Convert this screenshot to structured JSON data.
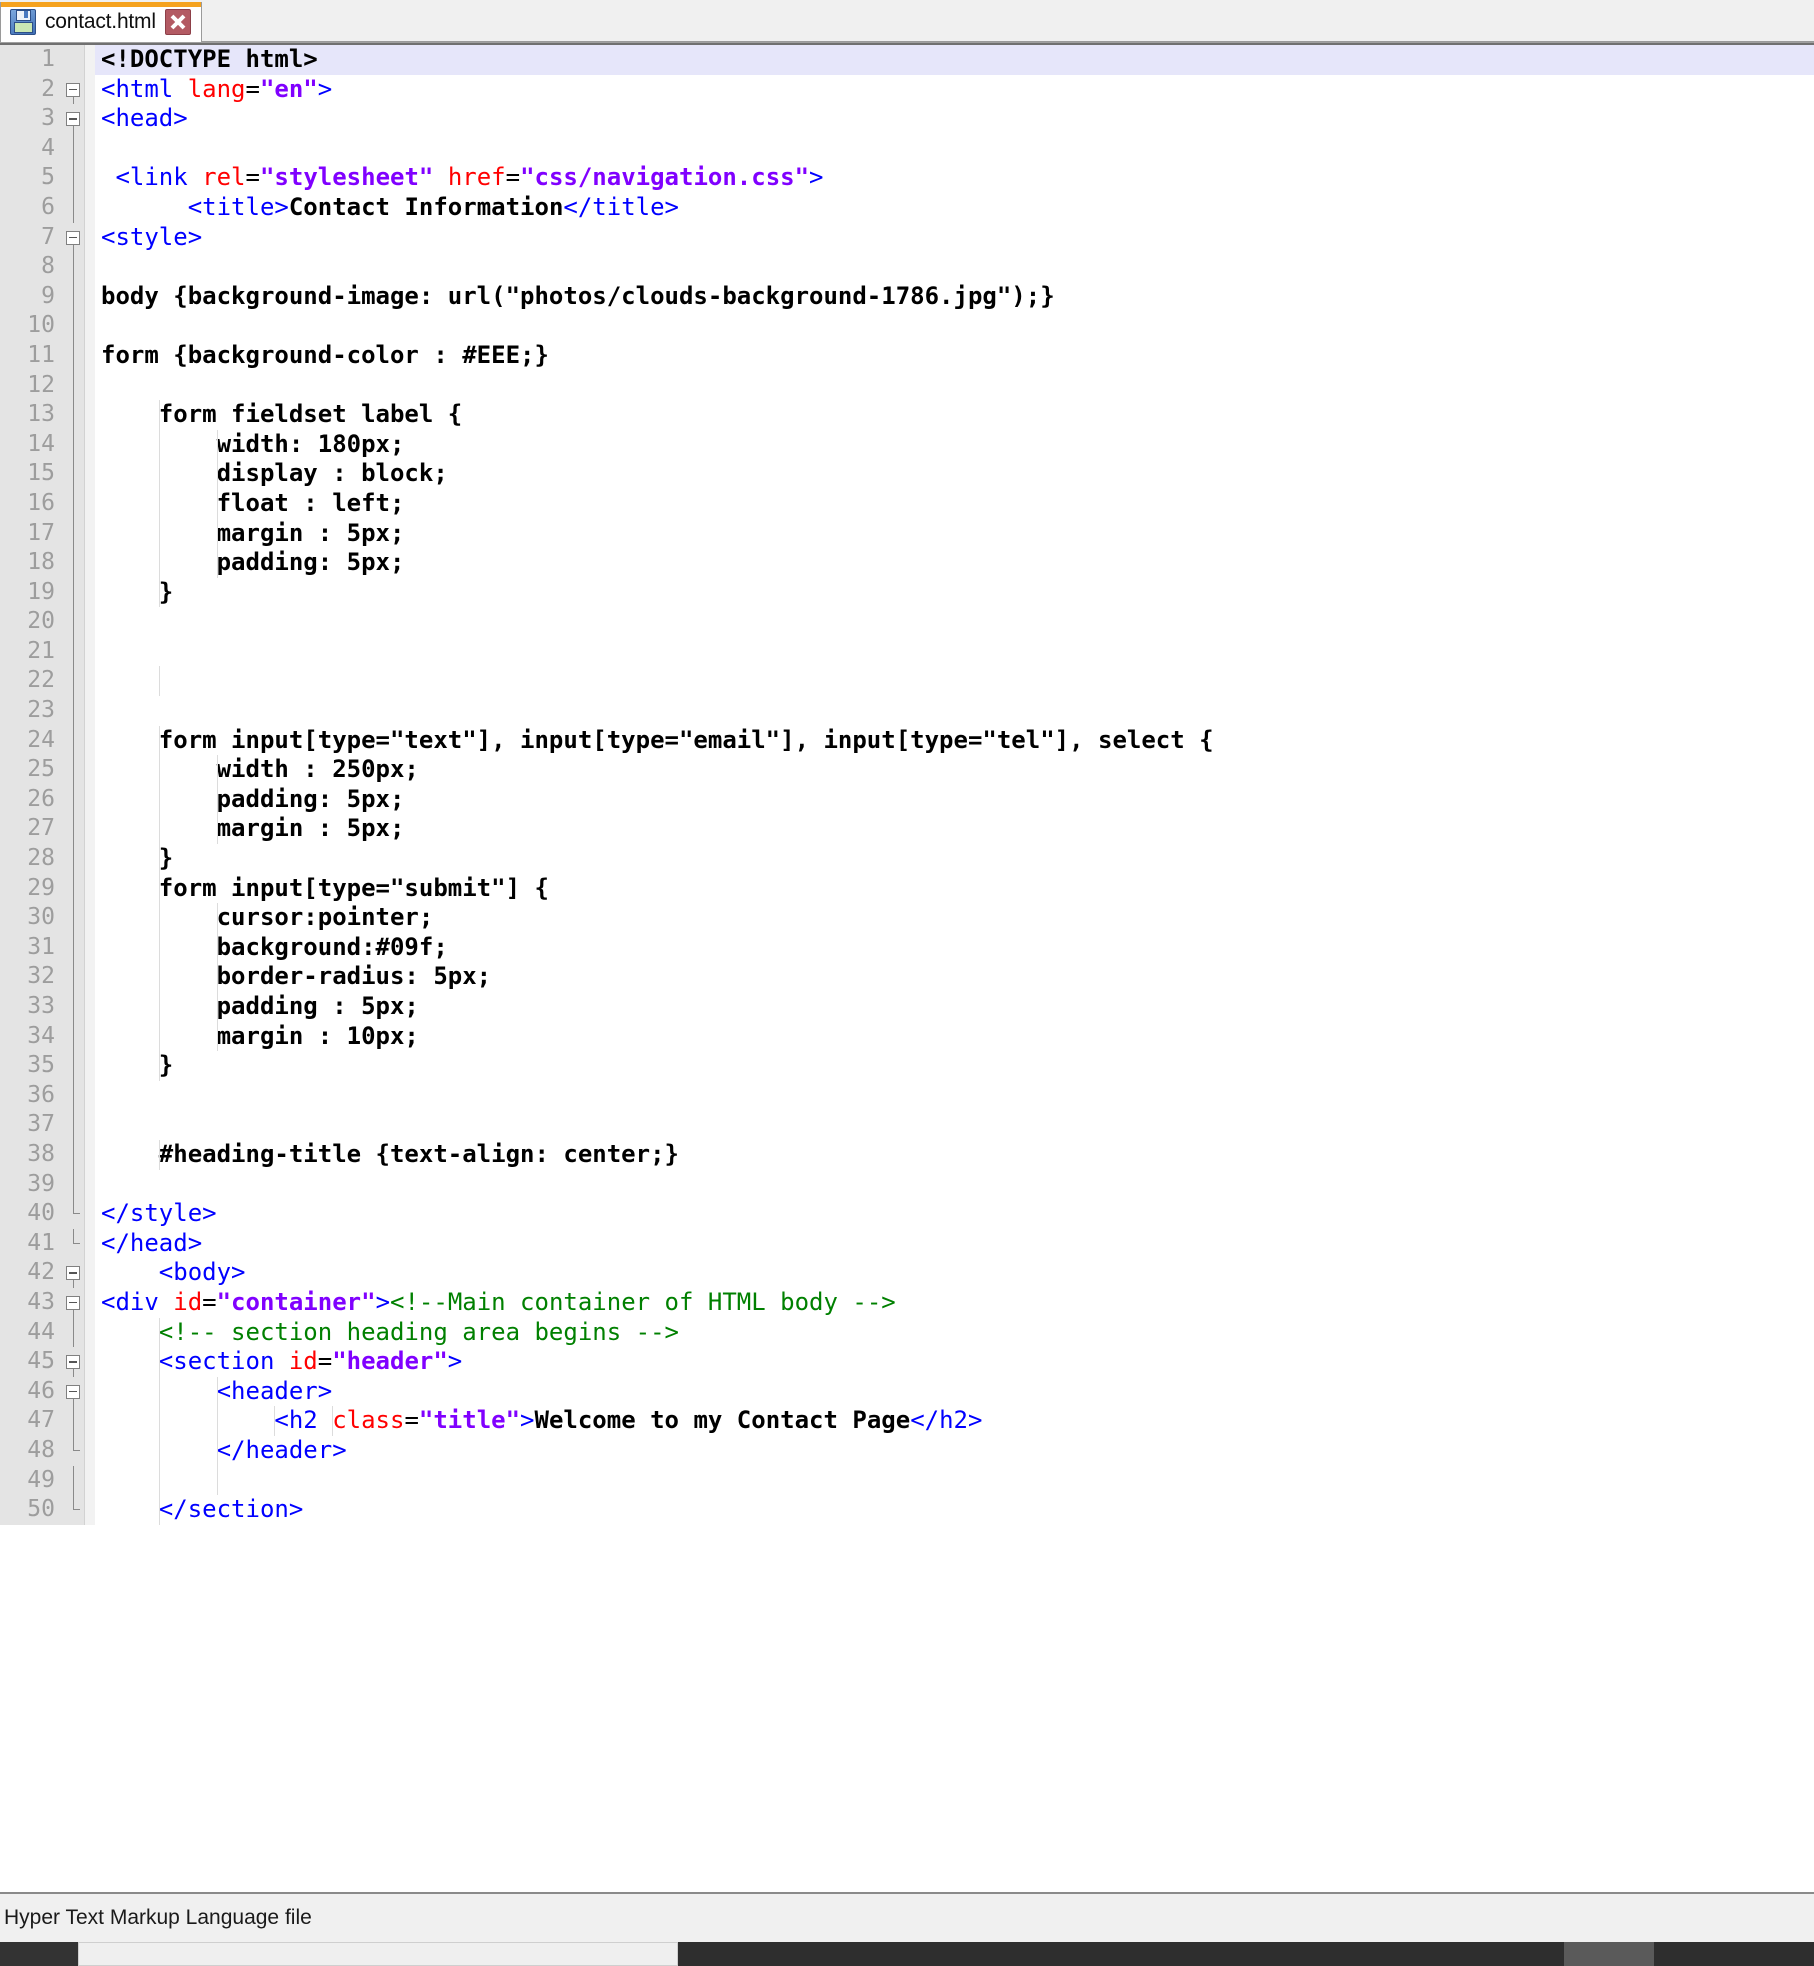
{
  "window": {
    "app": "text-editor",
    "accent_color": "#f5a21e",
    "current_line_highlight": "#e6e6fa"
  },
  "tabbar": {
    "tabs": [
      {
        "label": "contact.html",
        "save_icon": "floppy-disk-icon",
        "close_icon": "close-icon",
        "active": true
      }
    ]
  },
  "statusbar": {
    "text": "Hyper Text Markup Language file"
  },
  "scrollbar": {
    "orientation": "horizontal"
  },
  "editor": {
    "language": "HTML",
    "first_visible_line": 1,
    "last_visible_line": 50,
    "current_line": 1,
    "colors": {
      "tag": "#0000ff",
      "attribute": "#ff0000",
      "value": "#8000ff",
      "text": "#000000",
      "comment": "#008000",
      "gutter_bg": "#e4e4e4",
      "line_number": "#9d9d9d"
    },
    "lines": [
      {
        "n": 1,
        "fold": "none",
        "indent": 0,
        "tokens": [
          {
            "c": "txt",
            "s": "<!DOCTYPE html>"
          }
        ]
      },
      {
        "n": 2,
        "fold": "open",
        "indent": 0,
        "tokens": [
          {
            "c": "tag",
            "s": "<html "
          },
          {
            "c": "attr",
            "s": "lang"
          },
          {
            "c": "plain",
            "s": "="
          },
          {
            "c": "val",
            "s": "\"en\""
          },
          {
            "c": "tag",
            "s": ">"
          }
        ]
      },
      {
        "n": 3,
        "fold": "open",
        "indent": 0,
        "tokens": [
          {
            "c": "tag",
            "s": "<head>"
          }
        ]
      },
      {
        "n": 4,
        "fold": "line",
        "indent": 0,
        "tokens": []
      },
      {
        "n": 5,
        "fold": "line",
        "indent": 0,
        "tokens": [
          {
            "c": "plain",
            "s": " "
          },
          {
            "c": "tag",
            "s": "<link "
          },
          {
            "c": "attr",
            "s": "rel"
          },
          {
            "c": "plain",
            "s": "="
          },
          {
            "c": "val",
            "s": "\"stylesheet\""
          },
          {
            "c": "plain",
            "s": " "
          },
          {
            "c": "attr",
            "s": "href"
          },
          {
            "c": "plain",
            "s": "="
          },
          {
            "c": "val",
            "s": "\"css/navigation.css\""
          },
          {
            "c": "tag",
            "s": ">"
          }
        ]
      },
      {
        "n": 6,
        "fold": "line",
        "indent": 0,
        "tokens": [
          {
            "c": "plain",
            "s": "      "
          },
          {
            "c": "tag",
            "s": "<title>"
          },
          {
            "c": "txt",
            "s": "Contact Information"
          },
          {
            "c": "tag",
            "s": "</title>"
          }
        ]
      },
      {
        "n": 7,
        "fold": "open",
        "indent": 0,
        "tokens": [
          {
            "c": "tag",
            "s": "<style>"
          }
        ]
      },
      {
        "n": 8,
        "fold": "line",
        "indent": 0,
        "tokens": []
      },
      {
        "n": 9,
        "fold": "line",
        "indent": 0,
        "tokens": [
          {
            "c": "txt",
            "s": "body {background-image: url(\"photos/clouds-background-1786.jpg\");}"
          }
        ]
      },
      {
        "n": 10,
        "fold": "line",
        "indent": 0,
        "tokens": []
      },
      {
        "n": 11,
        "fold": "line",
        "indent": 0,
        "tokens": [
          {
            "c": "txt",
            "s": "form {background-color : #EEE;}"
          }
        ]
      },
      {
        "n": 12,
        "fold": "line",
        "indent": 0,
        "tokens": []
      },
      {
        "n": 13,
        "fold": "line",
        "indent": 1,
        "tokens": [
          {
            "c": "txt",
            "s": "    form fieldset label {"
          }
        ]
      },
      {
        "n": 14,
        "fold": "line",
        "indent": 2,
        "tokens": [
          {
            "c": "txt",
            "s": "        width: 180px;"
          }
        ]
      },
      {
        "n": 15,
        "fold": "line",
        "indent": 2,
        "tokens": [
          {
            "c": "txt",
            "s": "        display : block;"
          }
        ]
      },
      {
        "n": 16,
        "fold": "line",
        "indent": 2,
        "tokens": [
          {
            "c": "txt",
            "s": "        float : left;"
          }
        ]
      },
      {
        "n": 17,
        "fold": "line",
        "indent": 2,
        "tokens": [
          {
            "c": "txt",
            "s": "        margin : 5px;"
          }
        ]
      },
      {
        "n": 18,
        "fold": "line",
        "indent": 2,
        "tokens": [
          {
            "c": "txt",
            "s": "        padding: 5px;"
          }
        ]
      },
      {
        "n": 19,
        "fold": "line",
        "indent": 1,
        "tokens": [
          {
            "c": "txt",
            "s": "    }"
          }
        ]
      },
      {
        "n": 20,
        "fold": "line",
        "indent": 0,
        "tokens": []
      },
      {
        "n": 21,
        "fold": "line",
        "indent": 0,
        "tokens": []
      },
      {
        "n": 22,
        "fold": "line",
        "indent": 1,
        "tokens": []
      },
      {
        "n": 23,
        "fold": "line",
        "indent": 0,
        "tokens": []
      },
      {
        "n": 24,
        "fold": "line",
        "indent": 1,
        "tokens": [
          {
            "c": "txt",
            "s": "    form input[type=\"text\"], input[type=\"email\"], input[type=\"tel\"], select {"
          }
        ]
      },
      {
        "n": 25,
        "fold": "line",
        "indent": 2,
        "tokens": [
          {
            "c": "txt",
            "s": "        width : 250px;"
          }
        ]
      },
      {
        "n": 26,
        "fold": "line",
        "indent": 2,
        "tokens": [
          {
            "c": "txt",
            "s": "        padding: 5px;"
          }
        ]
      },
      {
        "n": 27,
        "fold": "line",
        "indent": 2,
        "tokens": [
          {
            "c": "txt",
            "s": "        margin : 5px;"
          }
        ]
      },
      {
        "n": 28,
        "fold": "line",
        "indent": 1,
        "tokens": [
          {
            "c": "txt",
            "s": "    }"
          }
        ]
      },
      {
        "n": 29,
        "fold": "line",
        "indent": 1,
        "tokens": [
          {
            "c": "txt",
            "s": "    form input[type=\"submit\"] {"
          }
        ]
      },
      {
        "n": 30,
        "fold": "line",
        "indent": 2,
        "tokens": [
          {
            "c": "txt",
            "s": "        cursor:pointer;"
          }
        ]
      },
      {
        "n": 31,
        "fold": "line",
        "indent": 2,
        "tokens": [
          {
            "c": "txt",
            "s": "        background:#09f;"
          }
        ]
      },
      {
        "n": 32,
        "fold": "line",
        "indent": 2,
        "tokens": [
          {
            "c": "txt",
            "s": "        border-radius: 5px;"
          }
        ]
      },
      {
        "n": 33,
        "fold": "line",
        "indent": 2,
        "tokens": [
          {
            "c": "txt",
            "s": "        padding : 5px;"
          }
        ]
      },
      {
        "n": 34,
        "fold": "line",
        "indent": 2,
        "tokens": [
          {
            "c": "txt",
            "s": "        margin : 10px;"
          }
        ]
      },
      {
        "n": 35,
        "fold": "line",
        "indent": 1,
        "tokens": [
          {
            "c": "txt",
            "s": "    }"
          }
        ]
      },
      {
        "n": 36,
        "fold": "line",
        "indent": 0,
        "tokens": []
      },
      {
        "n": 37,
        "fold": "line",
        "indent": 0,
        "tokens": []
      },
      {
        "n": 38,
        "fold": "line",
        "indent": 1,
        "tokens": [
          {
            "c": "txt",
            "s": "    #heading-title {text-align: center;}"
          }
        ]
      },
      {
        "n": 39,
        "fold": "line",
        "indent": 0,
        "tokens": []
      },
      {
        "n": 40,
        "fold": "end",
        "indent": 0,
        "tokens": [
          {
            "c": "tag",
            "s": "</style>"
          }
        ]
      },
      {
        "n": 41,
        "fold": "end",
        "indent": 0,
        "tokens": [
          {
            "c": "tag",
            "s": "</head>"
          }
        ]
      },
      {
        "n": 42,
        "fold": "open",
        "indent": 0,
        "tokens": [
          {
            "c": "plain",
            "s": "    "
          },
          {
            "c": "tag",
            "s": "<body>"
          }
        ]
      },
      {
        "n": 43,
        "fold": "open",
        "indent": 0,
        "tokens": [
          {
            "c": "tag",
            "s": "<div "
          },
          {
            "c": "attr",
            "s": "id"
          },
          {
            "c": "plain",
            "s": "="
          },
          {
            "c": "val",
            "s": "\"container\""
          },
          {
            "c": "tag",
            "s": ">"
          },
          {
            "c": "com",
            "s": "<!--Main container of HTML body -->"
          }
        ]
      },
      {
        "n": 44,
        "fold": "line",
        "indent": 1,
        "tokens": [
          {
            "c": "plain",
            "s": "    "
          },
          {
            "c": "com",
            "s": "<!-- section heading area begins -->"
          }
        ]
      },
      {
        "n": 45,
        "fold": "open",
        "indent": 1,
        "tokens": [
          {
            "c": "plain",
            "s": "    "
          },
          {
            "c": "tag",
            "s": "<section "
          },
          {
            "c": "attr",
            "s": "id"
          },
          {
            "c": "plain",
            "s": "="
          },
          {
            "c": "val",
            "s": "\"header\""
          },
          {
            "c": "tag",
            "s": ">"
          }
        ]
      },
      {
        "n": 46,
        "fold": "open",
        "indent": 2,
        "tokens": [
          {
            "c": "plain",
            "s": "        "
          },
          {
            "c": "tag",
            "s": "<header>"
          }
        ]
      },
      {
        "n": 47,
        "fold": "line",
        "indent": 4,
        "tokens": [
          {
            "c": "plain",
            "s": "            "
          },
          {
            "c": "tag",
            "s": "<h2 "
          },
          {
            "c": "attr",
            "s": "class"
          },
          {
            "c": "plain",
            "s": "="
          },
          {
            "c": "val",
            "s": "\"title\""
          },
          {
            "c": "tag",
            "s": ">"
          },
          {
            "c": "txt",
            "s": "Welcome to my Contact Page"
          },
          {
            "c": "tag",
            "s": "</h2>"
          }
        ]
      },
      {
        "n": 48,
        "fold": "end",
        "indent": 2,
        "tokens": [
          {
            "c": "plain",
            "s": "        "
          },
          {
            "c": "tag",
            "s": "</header>"
          }
        ]
      },
      {
        "n": 49,
        "fold": "line",
        "indent": 2,
        "tokens": []
      },
      {
        "n": 50,
        "fold": "end",
        "indent": 1,
        "tokens": [
          {
            "c": "plain",
            "s": "    "
          },
          {
            "c": "tag",
            "s": "</section>"
          }
        ]
      }
    ]
  }
}
